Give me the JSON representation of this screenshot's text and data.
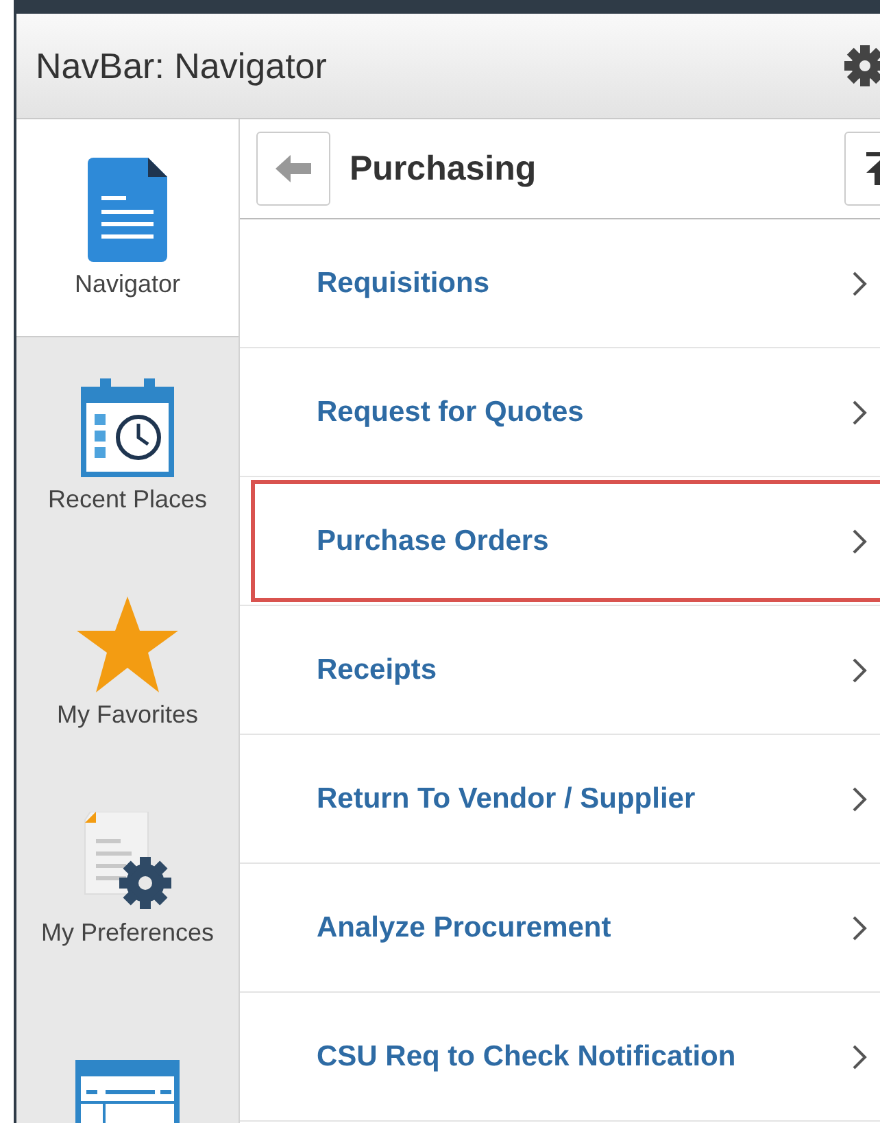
{
  "navbar": {
    "title": "NavBar: Navigator"
  },
  "sidebar": {
    "items": [
      {
        "kind": "document",
        "label": "Navigator",
        "selected": true
      },
      {
        "kind": "calendar",
        "label": "Recent Places",
        "selected": false
      },
      {
        "kind": "star",
        "label": "My Favorites",
        "selected": false
      },
      {
        "kind": "preferences",
        "label": "My Preferences",
        "selected": false
      },
      {
        "kind": "layout",
        "selected": false
      }
    ]
  },
  "panel": {
    "title": "Purchasing",
    "items": [
      {
        "label": "Requisitions",
        "highlighted": false
      },
      {
        "label": "Request for Quotes",
        "highlighted": false
      },
      {
        "label": "Purchase Orders",
        "highlighted": true
      },
      {
        "label": "Receipts",
        "highlighted": false
      },
      {
        "label": "Return To Vendor / Supplier",
        "highlighted": false
      },
      {
        "label": "Analyze Procurement",
        "highlighted": false
      },
      {
        "label": "CSU Req to Check Notification",
        "highlighted": false
      }
    ]
  }
}
